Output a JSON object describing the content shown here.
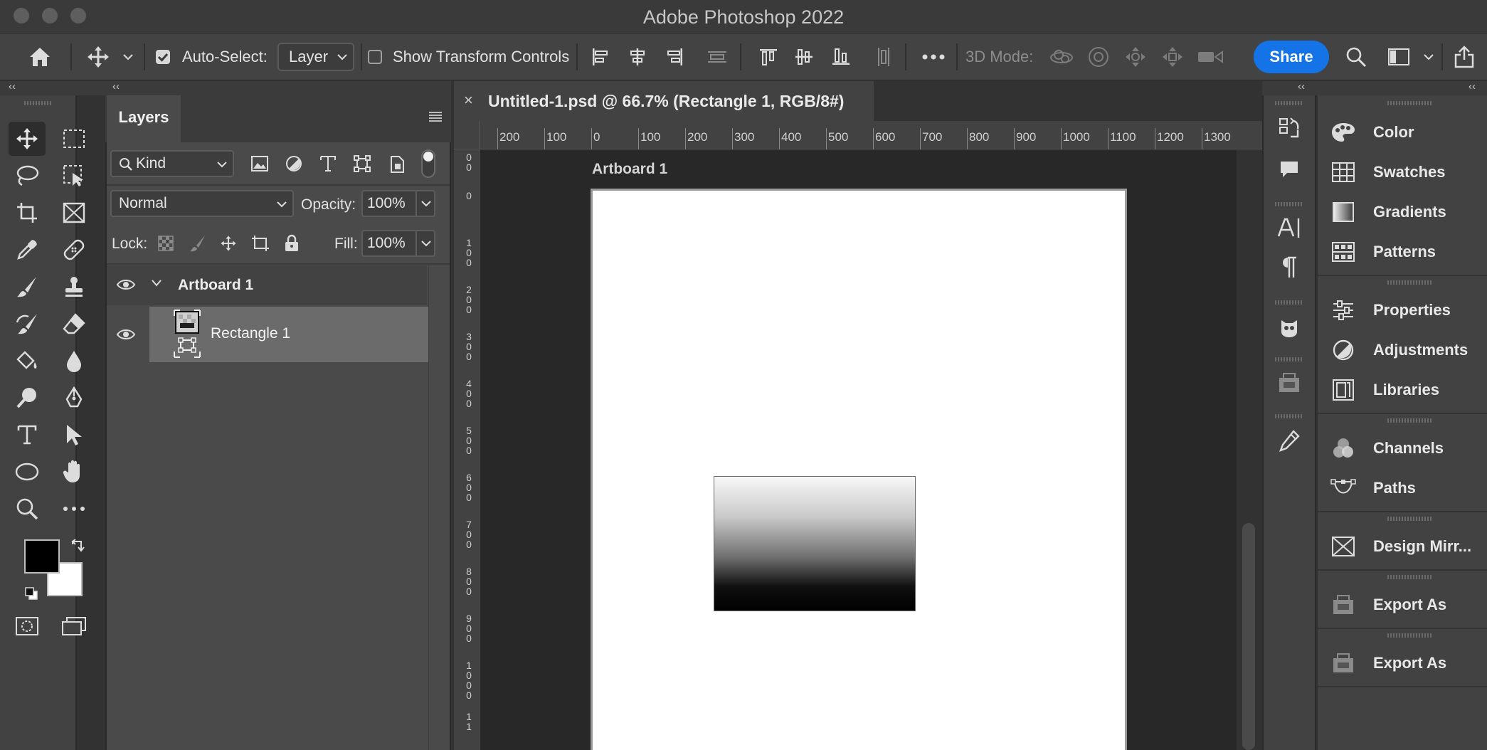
{
  "window": {
    "title": "Adobe Photoshop 2022"
  },
  "options_bar": {
    "auto_select_label": "Auto-Select:",
    "auto_select_checked": true,
    "auto_select_value": "Layer",
    "show_transform_label": "Show Transform Controls",
    "show_transform_checked": false,
    "mode_3d_label": "3D Mode:",
    "share_label": "Share"
  },
  "layers_panel": {
    "tab_label": "Layers",
    "filter_kind": "Kind",
    "blend_mode": "Normal",
    "opacity_label": "Opacity:",
    "opacity_value": "100%",
    "lock_label": "Lock:",
    "fill_label": "Fill:",
    "fill_value": "100%",
    "layers": [
      {
        "name": "Artboard 1",
        "type": "artboard",
        "visible": true,
        "expanded": true
      },
      {
        "name": "Rectangle 1",
        "type": "shape",
        "visible": true,
        "selected": true
      }
    ]
  },
  "document": {
    "tab_title": "Untitled-1.psd @ 66.7% (Rectangle 1, RGB/8#)",
    "close_glyph": "×",
    "artboard_label": "Artboard 1",
    "ruler_top": [
      "200",
      "100",
      "0",
      "100",
      "200",
      "300",
      "400",
      "500",
      "600",
      "700",
      "800",
      "900",
      "1000",
      "1100",
      "1200",
      "1300"
    ],
    "ruler_left": [
      "0\n0",
      "0",
      "1\n0\n0",
      "2\n0\n0",
      "3\n0\n0",
      "4\n0\n0",
      "5\n0\n0",
      "6\n0\n0",
      "7\n0\n0",
      "8\n0\n0",
      "9\n0\n0",
      "1\n0\n0\n0",
      "1\n1"
    ]
  },
  "right_panels": [
    {
      "label": "Color",
      "icon": "color-palette-icon"
    },
    {
      "label": "Swatches",
      "icon": "swatches-grid-icon"
    },
    {
      "label": "Gradients",
      "icon": "gradient-icon"
    },
    {
      "label": "Patterns",
      "icon": "patterns-icon"
    },
    {
      "label": "Properties",
      "icon": "sliders-icon"
    },
    {
      "label": "Adjustments",
      "icon": "adjustments-icon"
    },
    {
      "label": "Libraries",
      "icon": "libraries-icon"
    },
    {
      "label": "Channels",
      "icon": "channels-icon"
    },
    {
      "label": "Paths",
      "icon": "paths-icon"
    },
    {
      "label": "Design Mirr...",
      "icon": "design-mirror-icon"
    },
    {
      "label": "Export As",
      "icon": "export-as-icon"
    },
    {
      "label": "Export As",
      "icon": "export-as-icon"
    }
  ],
  "colors": {
    "foreground": "#000000",
    "background": "#ffffff",
    "accent": "#1473e6"
  }
}
